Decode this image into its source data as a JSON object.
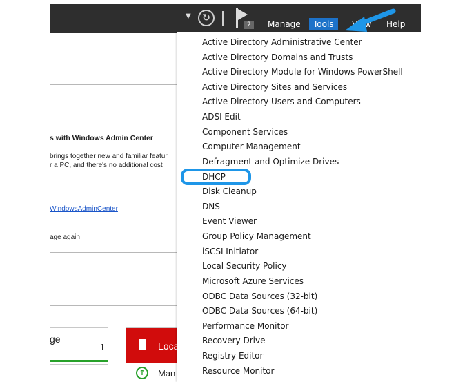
{
  "toolbar": {
    "flag_badge": "2",
    "menus": {
      "manage": "Manage",
      "tools": "Tools",
      "view": "View",
      "help": "Help"
    }
  },
  "background": {
    "heading": "s with Windows Admin Center",
    "line1": "brings together new and familiar featur",
    "line2": "r a PC, and there's no additional cost",
    "link": "WindowsAdminCenter",
    "footer": "age again",
    "tile_manage": {
      "label": "ge",
      "count": "1"
    },
    "tile_local": {
      "label": "Loca",
      "sub": "Man"
    }
  },
  "tools_menu": {
    "items": [
      "Active Directory Administrative Center",
      "Active Directory Domains and Trusts",
      "Active Directory Module for Windows PowerShell",
      "Active Directory Sites and Services",
      "Active Directory Users and Computers",
      "ADSI Edit",
      "Component Services",
      "Computer Management",
      "Defragment and Optimize Drives",
      "DHCP",
      "Disk Cleanup",
      "DNS",
      "Event Viewer",
      "Group Policy Management",
      "iSCSI Initiator",
      "Local Security Policy",
      "Microsoft Azure Services",
      "ODBC Data Sources (32-bit)",
      "ODBC Data Sources (64-bit)",
      "Performance Monitor",
      "Recovery Drive",
      "Registry Editor",
      "Resource Monitor"
    ],
    "highlighted_item": "DHCP"
  },
  "colors": {
    "toolbar_bg": "#2e2e2e",
    "active_menu": "#1d72c9",
    "annotation_blue": "#1e96e8",
    "alert_red": "#d10c0c",
    "ok_green": "#27a12a"
  }
}
